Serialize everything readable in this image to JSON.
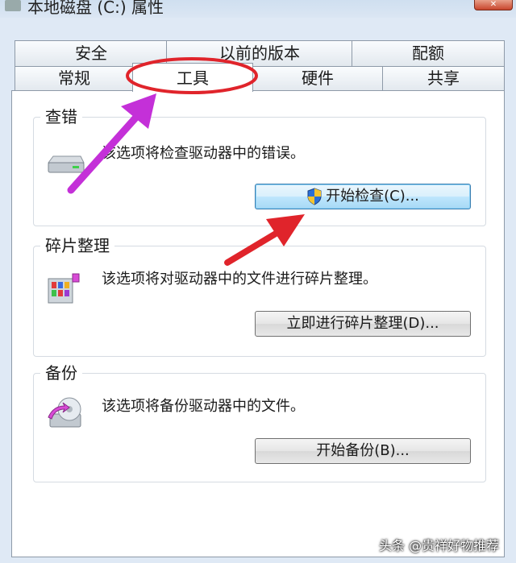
{
  "window": {
    "title": "本地磁盘 (C:) 属性",
    "close_label": "✕"
  },
  "tabs_row1": [
    {
      "label": "安全"
    },
    {
      "label": "以前的版本"
    },
    {
      "label": "配额"
    }
  ],
  "tabs_row2": [
    {
      "label": "常规"
    },
    {
      "label": "工具",
      "active": true
    },
    {
      "label": "硬件"
    },
    {
      "label": "共享"
    }
  ],
  "groups": {
    "check": {
      "title": "查错",
      "description": "该选项将检查驱动器中的错误。",
      "button": "开始检查(C)..."
    },
    "defrag": {
      "title": "碎片整理",
      "description": "该选项将对驱动器中的文件进行碎片整理。",
      "button": "立即进行碎片整理(D)..."
    },
    "backup": {
      "title": "备份",
      "description": "该选项将备份驱动器中的文件。",
      "button": "开始备份(B)..."
    }
  },
  "watermark": "头条 @贵祥好物推荐",
  "colors": {
    "annotation_ellipse": "#e0242b",
    "annotation_arrow_purple": "#c430d8",
    "annotation_arrow_red": "#e0242b"
  }
}
